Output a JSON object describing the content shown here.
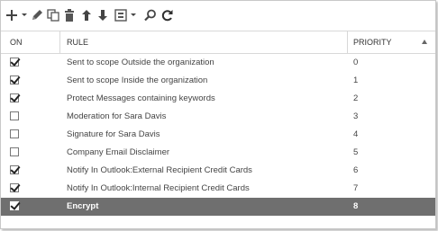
{
  "toolbar": {
    "items": [
      {
        "name": "add-icon"
      },
      {
        "name": "edit-icon"
      },
      {
        "name": "copy-icon"
      },
      {
        "name": "delete-icon"
      },
      {
        "name": "move-up-icon"
      },
      {
        "name": "move-down-icon"
      },
      {
        "name": "export-icon"
      },
      {
        "name": "search-icon"
      },
      {
        "name": "refresh-icon"
      }
    ]
  },
  "columns": {
    "on": "ON",
    "rule": "RULE",
    "priority": "PRIORITY"
  },
  "rows": [
    {
      "on": true,
      "rule": "Sent to scope Outside the organization",
      "priority": "0"
    },
    {
      "on": true,
      "rule": "Sent to scope Inside the organization",
      "priority": "1"
    },
    {
      "on": true,
      "rule": "Protect Messages containing keywords",
      "priority": "2"
    },
    {
      "on": false,
      "rule": "Moderation for Sara Davis",
      "priority": "3"
    },
    {
      "on": false,
      "rule": "Signature for Sara Davis",
      "priority": "4"
    },
    {
      "on": false,
      "rule": "Company Email Disclaimer",
      "priority": "5"
    },
    {
      "on": true,
      "rule": "Notify In Outlook:External Recipient Credit Cards",
      "priority": "6"
    },
    {
      "on": true,
      "rule": "Notify In Outlook:Internal Recipient Credit Cards",
      "priority": "7"
    },
    {
      "on": true,
      "rule": "Encrypt",
      "priority": "8",
      "selected": true
    }
  ],
  "colors": {
    "selected_row": "#6f6f6f",
    "icon": "#444444",
    "refresh": "#2f2f2f"
  }
}
